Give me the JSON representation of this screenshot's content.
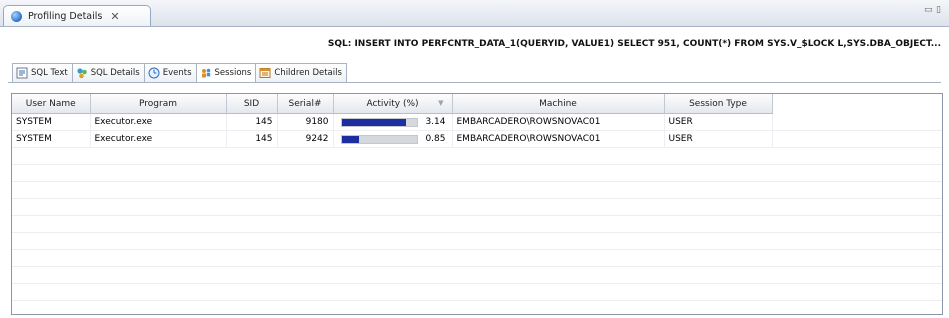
{
  "view": {
    "tab_label": "Profiling Details",
    "close_glyph": "✕"
  },
  "sql_header": "SQL: INSERT INTO PERFCNTR_DATA_1(QUERYID, VALUE1) SELECT 951, COUNT(*) FROM SYS.V_$LOCK L,SYS.DBA_OBJECT...",
  "subtabs": [
    {
      "label": "SQL Text",
      "icon": "sql-text-icon"
    },
    {
      "label": "SQL Details",
      "icon": "sql-details-icon"
    },
    {
      "label": "Events",
      "icon": "events-icon"
    },
    {
      "label": "Sessions",
      "icon": "sessions-icon"
    },
    {
      "label": "Children Details",
      "icon": "children-details-icon"
    }
  ],
  "table": {
    "columns": [
      "User Name",
      "Program",
      "SID",
      "Serial#",
      "Activity (%)",
      "Machine",
      "Session Type"
    ],
    "rows": [
      {
        "user": "SYSTEM",
        "program": "Executor.exe",
        "sid": "145",
        "serial": "9180",
        "activity": "3.14",
        "activity_fill": 0.86,
        "machine": "EMBARCADERO\\ROWSNOVAC01",
        "session_type": "USER"
      },
      {
        "user": "SYSTEM",
        "program": "Executor.exe",
        "sid": "145",
        "serial": "9242",
        "activity": "0.85",
        "activity_fill": 0.23,
        "machine": "EMBARCADERO\\ROWSNOVAC01",
        "session_type": "USER"
      }
    ]
  },
  "colors": {
    "activity_bar": "#1e2ea0",
    "activity_track": "#d5d8dd"
  }
}
